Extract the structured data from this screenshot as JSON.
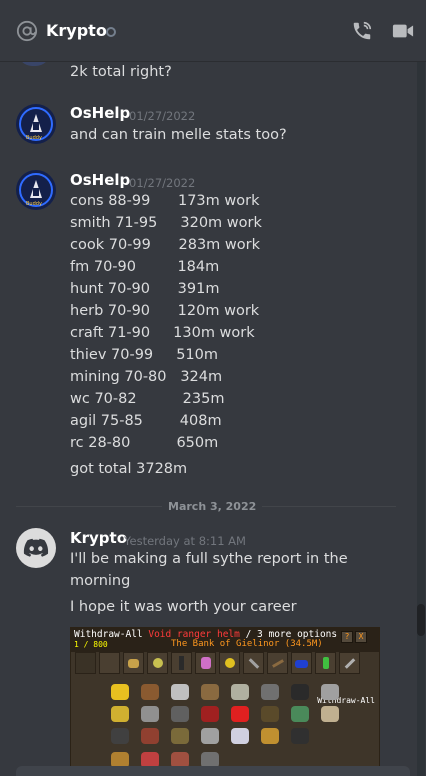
{
  "header": {
    "channel_name": "Krypto",
    "icons": [
      "at-icon",
      "status-offline-icon",
      "call-icon",
      "video-icon"
    ]
  },
  "partial_message": {
    "line1": "2k total right?"
  },
  "messages": [
    {
      "author": "OsHelp",
      "timestamp": "01/27/2022",
      "lines": [
        "and can train melle stats too?"
      ]
    },
    {
      "author": "OsHelp",
      "timestamp": "01/27/2022",
      "lines": [
        "cons 88-99      173m work",
        "smith 71-95     320m work",
        "cook 70-99      283m work",
        "fm 70-90         184m",
        "hunt 70-90      391m",
        "herb 70-90      120m work",
        "craft 71-90     130m work",
        "thiev 70-99     510m",
        "mining 70-80   324m",
        "wc 70-82          235m",
        "agil 75-85        408m",
        "rc 28-80          650m",
        "got total 3728m"
      ]
    }
  ],
  "divider": {
    "label": "March 3, 2022"
  },
  "krypto_message": {
    "author": "Krypto",
    "timestamp": "Yesterday at 8:11 AM",
    "line1": "I'll be making a full sythe report in the",
    "line2": "morning",
    "line3": "I hope it was worth your career"
  },
  "attachment": {
    "top_left_white": "Withdraw-All ",
    "top_left_red": "Void ranger helm",
    "top_left_white2": " / 3 more options",
    "title": "The Bank of Gielinor (34.5M)",
    "counter": "1 / 800",
    "side_text": "Withdraw-All"
  }
}
